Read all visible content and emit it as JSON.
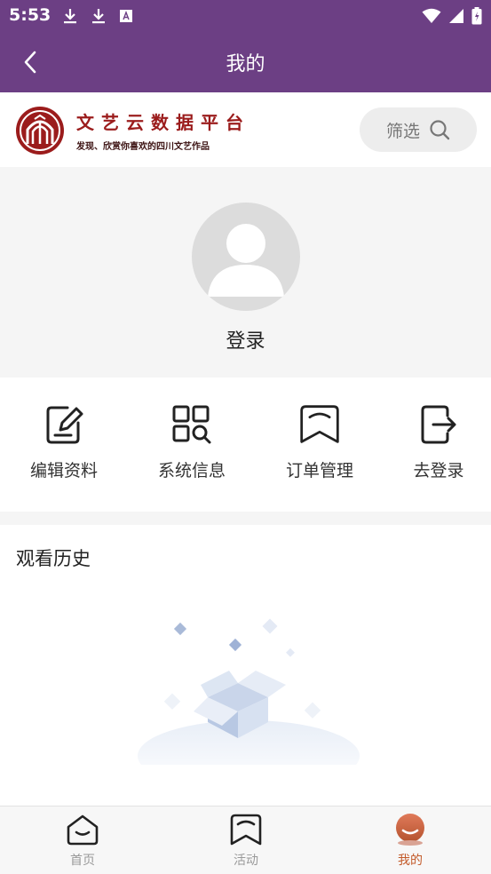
{
  "status_bar": {
    "time": "5:53"
  },
  "app_bar": {
    "title": "我的"
  },
  "brand": {
    "name": "文艺云数据平台",
    "slogan": "发现、欣赏你喜欢的四川文艺作品"
  },
  "filter": {
    "label": "筛选"
  },
  "profile": {
    "login_label": "登录"
  },
  "menu": {
    "items": [
      {
        "label": "编辑资料",
        "icon": "edit-icon"
      },
      {
        "label": "系统信息",
        "icon": "grid-search-icon"
      },
      {
        "label": "订单管理",
        "icon": "bookmark-icon"
      },
      {
        "label": "去登录",
        "icon": "login-icon"
      }
    ]
  },
  "history": {
    "title": "观看历史"
  },
  "tab_bar": {
    "tabs": [
      {
        "label": "首页",
        "icon": "home-icon",
        "active": false
      },
      {
        "label": "活动",
        "icon": "activity-icon",
        "active": false
      },
      {
        "label": "我的",
        "icon": "profile-icon",
        "active": true
      }
    ]
  },
  "colors": {
    "primary": "#6c3f84",
    "brand_red": "#9b1c1c",
    "active_tab": "#c35a2a"
  }
}
